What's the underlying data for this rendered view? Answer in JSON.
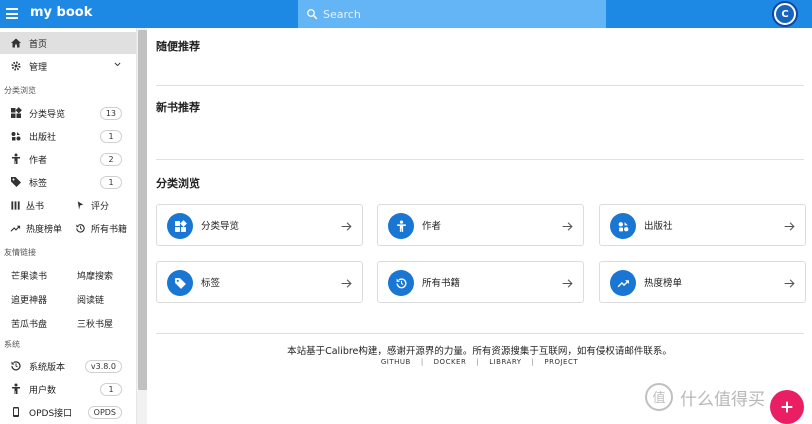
{
  "header": {
    "app_title": "my book",
    "search_placeholder": "Search",
    "avatar_letter": "C"
  },
  "sidebar": {
    "home": {
      "label": "首页",
      "icon": "home-icon"
    },
    "manage": {
      "label": "管理",
      "icon": "gear-icon"
    },
    "section_browse": "分类浏览",
    "browse_items": [
      {
        "label": "分类导览",
        "badge": "13",
        "icon": "grid-icon"
      },
      {
        "label": "出版社",
        "badge": "1",
        "icon": "publisher-icon"
      },
      {
        "label": "作者",
        "badge": "2",
        "icon": "person-icon"
      },
      {
        "label": "标签",
        "badge": "1",
        "icon": "tag-icon"
      }
    ],
    "series_label": "丛书",
    "rating_label": "评分",
    "hot_label": "热度榜单",
    "all_books_label": "所有书籍",
    "section_links": "友情链接",
    "links": [
      "芒果读书",
      "鸠摩搜索",
      "追更神器",
      "阅读链",
      "苦瓜书盘",
      "三秋书屋"
    ],
    "section_system": "系统",
    "system_items": [
      {
        "label": "系统版本",
        "badge": "v3.8.0",
        "icon": "history-icon"
      },
      {
        "label": "用户数",
        "badge": "1",
        "icon": "person-icon"
      },
      {
        "label": "OPDS接口",
        "badge": "OPDS",
        "icon": "phone-icon"
      }
    ]
  },
  "main": {
    "random_title": "随便推荐",
    "new_title": "新书推荐",
    "browse_title": "分类浏览",
    "cards": [
      {
        "label": "分类导览",
        "icon": "grid-icon"
      },
      {
        "label": "作者",
        "icon": "person-icon"
      },
      {
        "label": "出版社",
        "icon": "publisher-icon"
      },
      {
        "label": "标签",
        "icon": "tag-icon"
      },
      {
        "label": "所有书籍",
        "icon": "history-icon"
      },
      {
        "label": "热度榜单",
        "icon": "trending-icon"
      }
    ],
    "footer_text": "本站基于Calibre构建，感谢开源界的力量。所有资源搜集于互联网，如有侵权请邮件联系。",
    "footer_links": [
      "GITHUB",
      "DOCKER",
      "LIBRARY",
      "PROJECT"
    ]
  },
  "watermark": {
    "text": "什么值得买",
    "glyph": "值"
  },
  "colors": {
    "primary": "#1e88e5",
    "card_icon": "#1976d2",
    "fab": "#e91e63"
  }
}
